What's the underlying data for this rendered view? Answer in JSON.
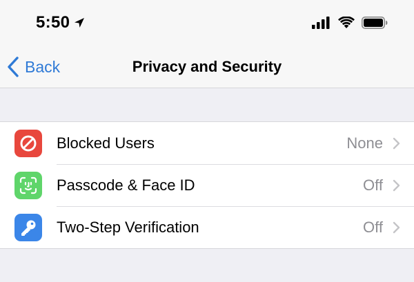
{
  "status_bar": {
    "time": "5:50",
    "icons": [
      "location-arrow-icon",
      "cellular-signal-icon",
      "wifi-icon",
      "battery-icon"
    ]
  },
  "nav": {
    "back_label": "Back",
    "title": "Privacy and Security"
  },
  "rows": [
    {
      "label": "Blocked Users",
      "value": "None",
      "icon": "blocked-icon",
      "icon_color": "#e8473d"
    },
    {
      "label": "Passcode & Face ID",
      "value": "Off",
      "icon": "face-id-icon",
      "icon_color": "#5fd56a"
    },
    {
      "label": "Two-Step Verification",
      "value": "Off",
      "icon": "key-icon",
      "icon_color": "#3b86e8"
    }
  ],
  "colors": {
    "accent": "#2f7ad6",
    "background": "#efeff4",
    "secondary_text": "#8e8e93"
  }
}
